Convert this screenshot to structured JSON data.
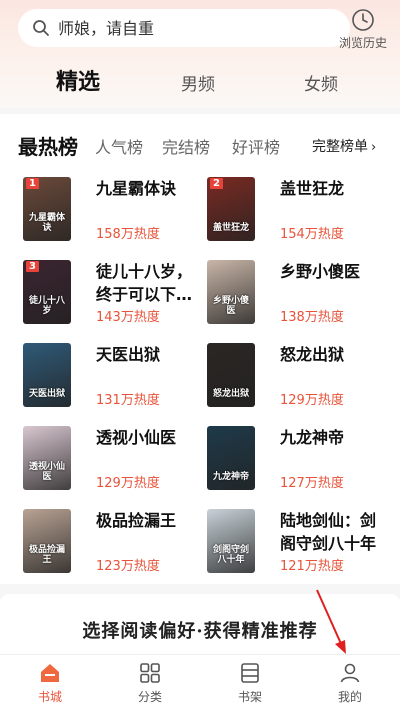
{
  "search": {
    "placeholder": "师娘，请自重"
  },
  "history": {
    "label": "浏览历史"
  },
  "top_tabs": [
    "精选",
    "男频",
    "女频"
  ],
  "rank_tabs": [
    "最热榜",
    "人气榜",
    "完结榜",
    "好评榜"
  ],
  "full_list_label": "完整榜单",
  "books": [
    {
      "rank": "1",
      "title": "九星霸体诀",
      "heat": "158万热度",
      "cover_text": "九星霸体诀",
      "cover_color": "#6b4a3a"
    },
    {
      "rank": "2",
      "title": "盖世狂龙",
      "heat": "154万热度",
      "cover_text": "盖世狂龙",
      "cover_color": "#7a2a22"
    },
    {
      "rank": "3",
      "title": "徒儿十八岁，终于可以下山…",
      "heat": "143万热度",
      "cover_text": "徒儿十八岁",
      "cover_color": "#3b2430"
    },
    {
      "rank": "",
      "title": "乡野小傻医",
      "heat": "138万热度",
      "cover_text": "乡野小傻医",
      "cover_color": "#c9b6a8"
    },
    {
      "rank": "",
      "title": "天医出狱",
      "heat": "131万热度",
      "cover_text": "天医出狱",
      "cover_color": "#2f5a78"
    },
    {
      "rank": "",
      "title": "怒龙出狱",
      "heat": "129万热度",
      "cover_text": "怒龙出狱",
      "cover_color": "#2b2623"
    },
    {
      "rank": "",
      "title": "透视小仙医",
      "heat": "129万热度",
      "cover_text": "透视小仙医",
      "cover_color": "#d9c7d0"
    },
    {
      "rank": "",
      "title": "九龙神帝",
      "heat": "127万热度",
      "cover_text": "九龙神帝",
      "cover_color": "#1e3a4a"
    },
    {
      "rank": "",
      "title": "极品捡漏王",
      "heat": "123万热度",
      "cover_text": "极品捡漏王",
      "cover_color": "#b9a394"
    },
    {
      "rank": "",
      "title": "陆地剑仙：剑阁守剑八十年",
      "heat": "121万热度",
      "cover_text": "剑阁守剑八十年",
      "cover_color": "#c8d2d8"
    }
  ],
  "promo_text": "选择阅读偏好·获得精准推荐",
  "nav": [
    "书城",
    "分类",
    "书架",
    "我的"
  ],
  "colors": {
    "accent": "#e8533a",
    "annotation_arrow": "#e02020"
  }
}
